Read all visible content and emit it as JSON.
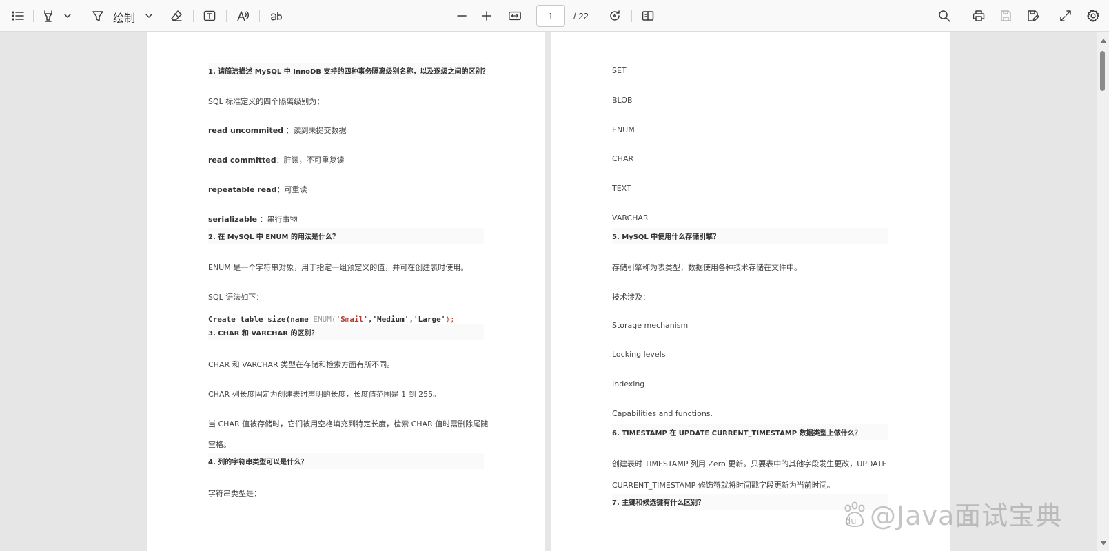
{
  "toolbar": {
    "draw_label": "绘制",
    "page_current": "1",
    "page_total": "/ 22"
  },
  "left_page": {
    "q1_title": "1. 请简洁描述 MySQL 中 InnoDB 支持的四种事务隔离级别名称，以及逐级之间的区别？",
    "q1_intro": "SQL 标准定义的四个隔离级别为：",
    "q1_l1_term": "read uncommited",
    "q1_l1_desc": " ：读到未提交数据",
    "q1_l2_term": "read committed",
    "q1_l2_desc": "：脏读，不可重复读",
    "q1_l3_term": "repeatable read",
    "q1_l3_desc": "：可重读",
    "q1_l4_term": "serializable",
    "q1_l4_desc": " ：串行事物",
    "q2_title": "2. 在 MySQL 中 ENUM 的用法是什么？",
    "q2_p1": "ENUM 是一个字符串对象，用于指定一组预定义的值，并可在创建表时使用。",
    "q2_p2": "SQL 语法如下：",
    "q2_code_a": "Create table size(name ",
    "q2_code_kw": "ENUM(",
    "q2_code_s1": "'Smail'",
    "q2_code_c1": ",",
    "q2_code_s2": "'Medium'",
    "q2_code_c2": ",",
    "q2_code_s3": "'Large'",
    "q2_code_end": ");",
    "q3_title": "3. CHAR 和 VARCHAR 的区别？",
    "q3_p1": "CHAR 和 VARCHAR 类型在存储和检索方面有所不同。",
    "q3_p2": "CHAR 列长度固定为创建表时声明的长度，长度值范围是 1 到 255。",
    "q3_p3a": "当 CHAR 值被存储时，它们被用空格填充到特定长度，检索 CHAR 值时需删除尾随",
    "q3_p3b": "空格。",
    "q4_title": "4. 列的字符串类型可以是什么？",
    "q4_p1": "字符串类型是："
  },
  "right_page": {
    "t1": "SET",
    "t2": "BLOB",
    "t3": "ENUM",
    "t4": "CHAR",
    "t5": "TEXT",
    "t6": "VARCHAR",
    "q5_title": "5. MySQL 中使用什么存储引擎？",
    "q5_p1": "存储引擎称为表类型，数据使用各种技术存储在文件中。",
    "q5_p2": "技术涉及：",
    "q5_i1": "Storage mechanism",
    "q5_i2": "Locking levels",
    "q5_i3": "Indexing",
    "q5_i4": "Capabilities and functions.",
    "q6_title": "6. TIMESTAMP 在 UPDATE CURRENT_TIMESTAMP 数据类型上做什么？",
    "q6_p1a": "创建表时 TIMESTAMP 列用 Zero 更新。只要表中的其他字段发生更改，UPDATE",
    "q6_p1b": "CURRENT_TIMESTAMP 修饰符就将时间戳字段更新为当前时间。",
    "q7_title": "7. 主键和候选键有什么区别？"
  },
  "watermark": {
    "text": "@Java面试宝典",
    "du": "du"
  }
}
